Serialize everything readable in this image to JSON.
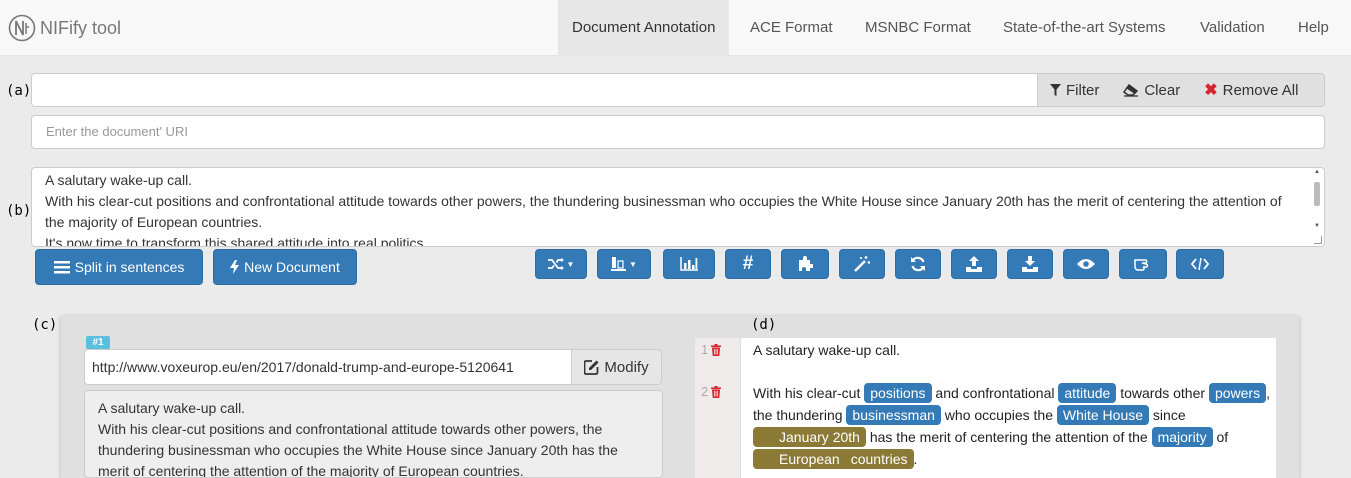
{
  "app": {
    "title": "NIFify tool"
  },
  "nav": {
    "items": [
      {
        "label": "Document Annotation",
        "active": true
      },
      {
        "label": "ACE Format"
      },
      {
        "label": "MSNBC Format"
      },
      {
        "label": "State-of-the-art Systems"
      },
      {
        "label": "Validation"
      },
      {
        "label": "Help"
      }
    ]
  },
  "labels": {
    "a": "(a)",
    "b": "(b)",
    "c": "(c)",
    "d": "(d)"
  },
  "filter": {
    "value": "",
    "filter_label": "Filter",
    "clear_label": "Clear",
    "remove_all_label": "Remove All"
  },
  "uri": {
    "placeholder": "Enter the document' URI"
  },
  "document": {
    "text": "A salutary wake-up call.\nWith his clear-cut positions and confrontational attitude towards other powers, the thundering businessman who occupies the White House since January 20th has the merit of centering the attention of the majority of European countries.\nIt's now time to transform this shared attitude into real politics."
  },
  "buttons": {
    "split": "Split in sentences",
    "new_document": "New Document"
  },
  "toolbar": {
    "icons": [
      "shuffle-icon",
      "align-bottom-icon",
      "bar-chart-icon",
      "hashtag-icon",
      "puzzle-icon",
      "magic-wand-icon",
      "refresh-icon",
      "upload-icon",
      "download-icon",
      "eye-icon",
      "hand-pointer-icon",
      "code-icon"
    ]
  },
  "panel": {
    "badge": "#1",
    "url": "http://www.voxeurop.eu/en/2017/donald-trump-and-europe-5120641",
    "modify_label": "Modify",
    "doc_text": "A salutary wake-up call.\nWith his clear-cut positions and confrontational attitude towards other powers, the thundering businessman who occupies the White House since January 20th has the merit of centering the attention of the majority of European countries."
  },
  "annotation": {
    "line1": "1",
    "line2": "2",
    "sentence1": "A salutary wake-up call.",
    "s2": {
      "t1": "With his clear-cut ",
      "e1": "positions",
      "t2": " and confrontational ",
      "e2": "attitude",
      "t3": " towards other ",
      "e3": "powers",
      "t4": ", the thundering ",
      "e4": "businessman",
      "t5": " who occupies the ",
      "e5": "White House",
      "t6": " since ",
      "e6": "January 20th",
      "t7": " has the merit of centering the attention of the ",
      "e7": "majority",
      "t8": " of ",
      "e8": "European",
      "e9": "countries",
      "t9": "."
    },
    "colors": {
      "concept": "#337ab7",
      "named_entity": "#8b7a35"
    }
  }
}
